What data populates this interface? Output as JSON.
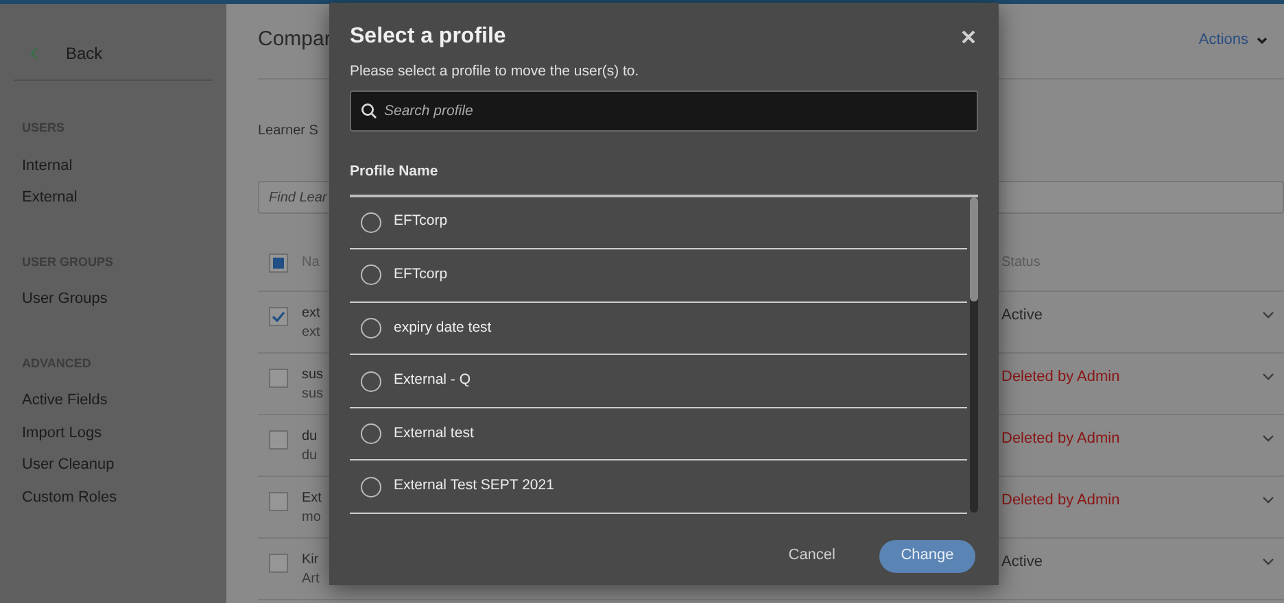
{
  "sidebar": {
    "back": "Back",
    "sections": [
      {
        "heading": "USERS",
        "items": [
          "Internal",
          "External"
        ]
      },
      {
        "heading": "USER GROUPS",
        "items": [
          "User Groups"
        ]
      },
      {
        "heading": "ADVANCED",
        "items": [
          "Active Fields",
          "Import Logs",
          "User Cleanup",
          "Custom Roles"
        ]
      }
    ]
  },
  "page": {
    "title": "Compar",
    "actions": "Actions",
    "filter_label": "Learner S",
    "search": {
      "placeholder": "Find Lear"
    },
    "table": {
      "header": {
        "indeterminate": true,
        "columns": [
          "Na",
          "Status"
        ]
      },
      "rows": [
        {
          "checked": true,
          "name": "ext",
          "detail": "ext",
          "status": "Active",
          "kind": "active"
        },
        {
          "checked": false,
          "name": "sus",
          "detail": "sus",
          "status": "Deleted by Admin",
          "kind": "deleted"
        },
        {
          "checked": false,
          "name": "du",
          "detail": "du",
          "status": "Deleted by Admin",
          "kind": "deleted"
        },
        {
          "checked": false,
          "name": "Ext",
          "detail": "mo",
          "status": "Deleted by Admin",
          "kind": "deleted"
        },
        {
          "checked": false,
          "name": "Kir",
          "detail": "Art",
          "status": "Active",
          "kind": "active"
        }
      ]
    }
  },
  "modal": {
    "title": "Select a profile",
    "subtitle": "Please select a profile to move the user(s) to.",
    "search": {
      "placeholder": "Search profile"
    },
    "column": "Profile Name",
    "profiles": [
      {
        "name": "EFTcorp",
        "selected": false
      },
      {
        "name": "EFTcorp",
        "selected": false
      },
      {
        "name": "expiry date test",
        "selected": false
      },
      {
        "name": "External - Q",
        "selected": false
      },
      {
        "name": "External test",
        "selected": false
      },
      {
        "name": "External Test SEPT 2021",
        "selected": false
      }
    ],
    "buttons": {
      "cancel": "Cancel",
      "change": "Change"
    }
  }
}
